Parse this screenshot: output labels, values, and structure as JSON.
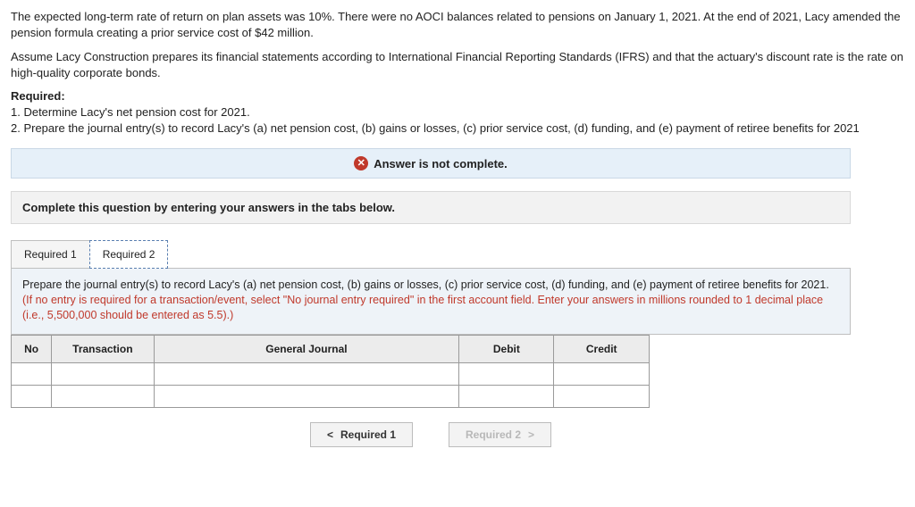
{
  "intro": {
    "p1": "The expected long-term rate of return on plan assets was 10%. There were no AOCI balances related to pensions on January 1, 2021. At the end of 2021, Lacy amended the pension formula creating a prior service cost of $42 million.",
    "p2": "Assume Lacy Construction prepares its financial statements according to International Financial Reporting Standards (IFRS) and that the actuary's discount rate is the rate on high-quality corporate bonds."
  },
  "required": {
    "label": "Required:",
    "item1": "1. Determine Lacy's net pension cost for 2021.",
    "item2": "2. Prepare the journal entry(s) to record Lacy's (a) net pension cost, (b) gains or losses, (c) prior service cost, (d) funding, and (e) payment of retiree benefits for 2021"
  },
  "status": {
    "text": "Answer is not complete.",
    "icon": "✕"
  },
  "instruction": "Complete this question by entering your answers in the tabs below.",
  "tabs": {
    "t1": "Required 1",
    "t2": "Required 2"
  },
  "tabbody": {
    "main": "Prepare the journal entry(s) to record Lacy's (a) net pension cost, (b) gains or losses, (c) prior service cost, (d) funding, and (e) payment of retiree benefits for 2021. ",
    "hint": "(If no entry is required for a transaction/event, select \"No journal entry required\" in the first account field. Enter your answers in millions rounded to 1 decimal place (i.e., 5,500,000 should be entered as 5.5).)"
  },
  "table": {
    "h_no": "No",
    "h_trans": "Transaction",
    "h_gj": "General Journal",
    "h_debit": "Debit",
    "h_credit": "Credit"
  },
  "nav": {
    "prev": "Required 1",
    "next": "Required 2"
  }
}
